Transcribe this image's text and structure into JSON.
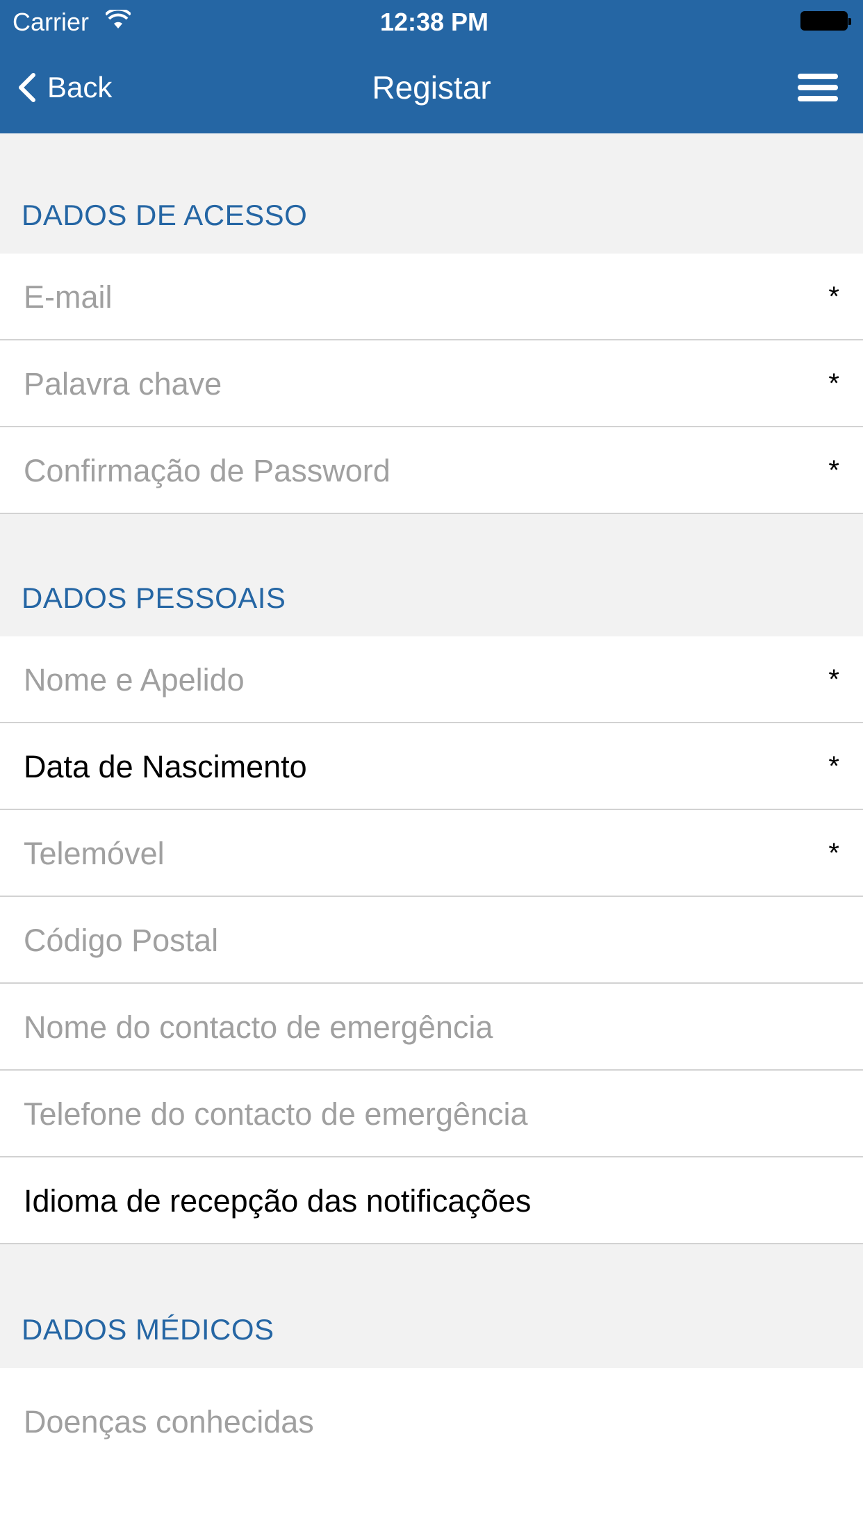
{
  "status_bar": {
    "carrier": "Carrier",
    "time": "12:38 PM"
  },
  "nav": {
    "back_label": "Back",
    "title": "Registar"
  },
  "sections": {
    "access": {
      "title": "DADOS DE ACESSO",
      "email_placeholder": "E-mail",
      "password_placeholder": "Palavra chave",
      "confirm_placeholder": "Confirmação de Password"
    },
    "personal": {
      "title": "DADOS PESSOAIS",
      "name_placeholder": "Nome e Apelido",
      "birthdate_label": "Data de Nascimento",
      "mobile_placeholder": "Telemóvel",
      "postal_placeholder": "Código Postal",
      "emergency_name_placeholder": "Nome do contacto de emergência",
      "emergency_phone_placeholder": "Telefone do contacto de emergência",
      "language_label": "Idioma de recepção das notificações"
    },
    "medical": {
      "title": "DADOS MÉDICOS",
      "diseases_placeholder": "Doenças conhecidas"
    }
  },
  "required_marker": "*",
  "colors": {
    "brand_blue": "#2566a4",
    "placeholder_gray": "#a0a0a0",
    "background": "#f2f2f2",
    "separator": "#d2d2d2"
  }
}
